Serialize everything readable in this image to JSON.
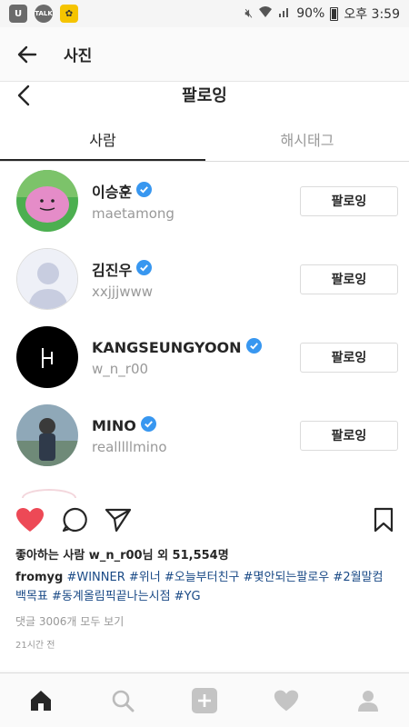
{
  "status_bar": {
    "apps": [
      {
        "icon": "u-app-icon",
        "text": "U",
        "color": "#6b6b6b"
      },
      {
        "icon": "talk-icon",
        "text": "TALK",
        "color": "#6b6b6b"
      },
      {
        "icon": "yellow-app-icon",
        "text": "",
        "color": "#f5c400"
      }
    ],
    "battery": "90%",
    "time": "오후 3:59"
  },
  "app_bar": {
    "title": "사진"
  },
  "modal": {
    "title": "팔로잉",
    "tabs": [
      {
        "label": "사람",
        "active": true
      },
      {
        "label": "해시태그",
        "active": false
      }
    ],
    "users": [
      {
        "name": "이승훈",
        "handle": "maetamong",
        "verified": true,
        "button": "팔로잉",
        "avatar": "pink-character"
      },
      {
        "name": "김진우",
        "handle": "xxjjjwww",
        "verified": true,
        "button": "팔로잉",
        "avatar": "default-silhouette"
      },
      {
        "name": "KANGSEUNGYOON",
        "handle": "w_n_r00",
        "verified": true,
        "button": "팔로잉",
        "avatar": "black-logo"
      },
      {
        "name": "MINO",
        "handle": "realllllmino",
        "verified": true,
        "button": "팔로잉",
        "avatar": "photo-person"
      }
    ]
  },
  "post": {
    "liked": true,
    "likes": "좋아하는 사람 w_n_r00님 외 51,554명",
    "author": "fromyg",
    "hashtags": [
      "#WINNER",
      "#위너",
      "#오늘부터친구",
      "#몇안되는팔로우",
      "#2월말컴백목표",
      "#동계올림픽끝나는시점",
      "#YG"
    ],
    "comments": "댓글 3006개 모두 보기",
    "time": "21시간 전"
  },
  "colors": {
    "heart": "#ed4956",
    "verified": "#3897f0",
    "tag": "#1a4a86"
  }
}
